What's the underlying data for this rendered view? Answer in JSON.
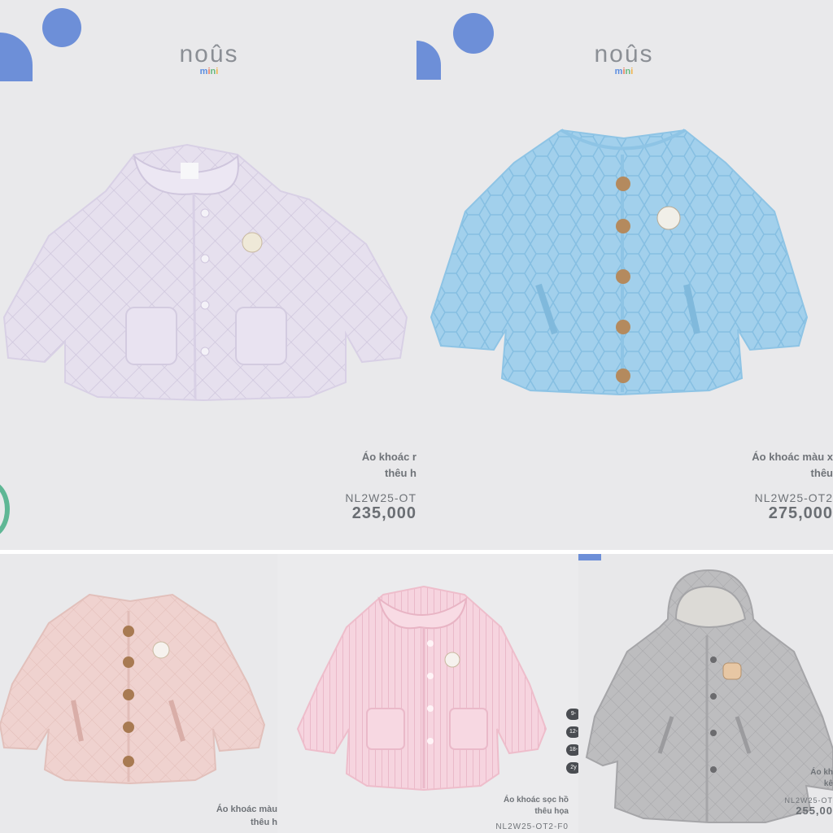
{
  "brand": {
    "logo_text": "noûs",
    "logo_sub": "mini"
  },
  "products": [
    {
      "name_line1": "Áo khoác r",
      "name_line2": "thêu h",
      "code": "NL2W25-OT",
      "price": "235,000",
      "color": "#e7e1ef"
    },
    {
      "name_line1": "Áo khoác màu x",
      "name_line2": "thêu",
      "code": "NL2W25-OT2",
      "price": "275,000",
      "color": "#9fcdeb"
    },
    {
      "name_line1": "Áo khoác màu",
      "name_line2": "thêu h",
      "color": "#eecfcd"
    },
    {
      "name_line1": "Áo khoác sọc hồ",
      "name_line2": "thêu họa",
      "code": "NL2W25-OT2-F0",
      "color": "#f5d2dd"
    },
    {
      "name_line1": "Áo kh",
      "name_line2": "kê",
      "code": "NL2W25-OT",
      "price": "255,00",
      "color": "#b9b9bb"
    }
  ],
  "size_chips": [
    "9-",
    "12-",
    "18-",
    "2y"
  ],
  "accent_blue": "#6d8fd8",
  "accent_green": "#5fb795"
}
